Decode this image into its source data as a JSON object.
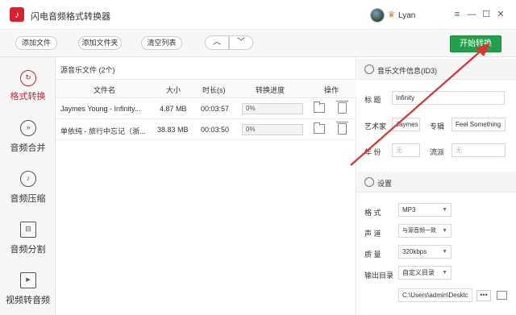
{
  "window": {
    "title": "闪电音频格式转换器",
    "username": "Lyan",
    "icons": [
      "minimize-line-icon",
      "minimize-icon",
      "maximize-icon",
      "close-icon"
    ]
  },
  "toolbar": {
    "add_file": "添加文件",
    "add_folder": "添加文件夹",
    "clear_list": "清空列表",
    "move_up": "︿",
    "move_down": "﹀",
    "start": "开始转换",
    "start_color": "#24a04a"
  },
  "sidebar": {
    "accent": "#d8232e",
    "items": [
      {
        "label": "格式转换",
        "icon": "refresh-icon",
        "glyph": "↻",
        "active": true
      },
      {
        "label": "音频合并",
        "icon": "merge-icon",
        "glyph": "»",
        "active": false
      },
      {
        "label": "音频压缩",
        "icon": "music-note-icon",
        "glyph": "♪",
        "active": false
      },
      {
        "label": "音频分割",
        "icon": "split-icon",
        "glyph": "⊟",
        "active": false
      },
      {
        "label": "视频转音频",
        "icon": "play-icon",
        "glyph": "▶",
        "active": false
      }
    ]
  },
  "filelist": {
    "title": "源音乐文件 (2个)",
    "headers": {
      "name": "文件名",
      "size": "大小",
      "duration": "时长(s)",
      "progress": "转换进度",
      "ops": "操作"
    },
    "rows": [
      {
        "name": "Jaymes Young - Infinity...",
        "size": "4.87 MB",
        "duration": "00:03:57",
        "progress": "0%"
      },
      {
        "name": "单依纯 - 旅行中忘记（浙...",
        "size": "38.83 MB",
        "duration": "00:03:50",
        "progress": "0%"
      }
    ]
  },
  "id3": {
    "section": "音乐文件信息(ID3)",
    "title_label": "标  题",
    "title_value": "Infinity",
    "artist_label": "艺术家",
    "artist_value": "Jaymes",
    "album_label": "专辑",
    "album_value": "Feel Something",
    "year_label": "年  份",
    "year_placeholder": "无",
    "genre_label": "流派",
    "genre_placeholder": "无"
  },
  "settings": {
    "section": "设置",
    "format_label": "格  式",
    "format_value": "MP3",
    "channel_label": "声  道",
    "channel_value": "与源音频一致",
    "quality_label": "质  量",
    "quality_value": "320kbps",
    "output_label": "输出目录",
    "output_value": "自定义目录",
    "path_value": "C:\\Users\\admin\\Desktc",
    "dots": "•••"
  }
}
